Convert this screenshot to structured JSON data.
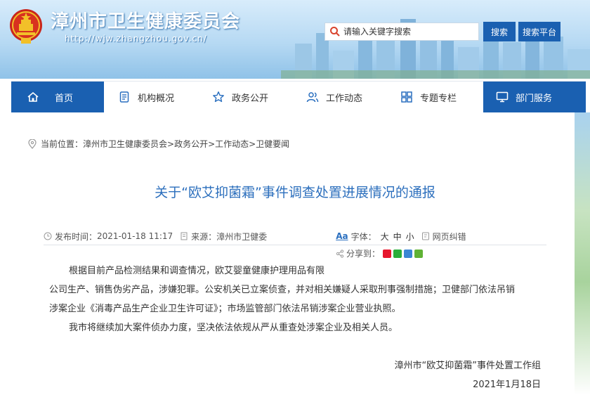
{
  "site": {
    "title": "漳州市卫生健康委员会",
    "url": "http://wjw.zhangzhou.gov.cn/"
  },
  "search": {
    "placeholder": "请输入关键字搜索",
    "search_label": "搜索",
    "platform_label": "搜索平台"
  },
  "nav": {
    "home": "首页",
    "org": "机构概况",
    "gov": "政务公开",
    "work": "工作动态",
    "topic": "专题专栏",
    "service": "部门服务"
  },
  "breadcrumb": {
    "prefix": "当前位置：",
    "path": "漳州市卫生健康委员会>政务公开>工作动态>卫健要闻"
  },
  "article": {
    "title": "关于“欧艾抑菌霜”事件调查处置进展情况的通报",
    "published_label": "发布时间：",
    "published": "2021-01-18 11:17",
    "source_label": "来源：",
    "source": "漳州市卫健委",
    "font_label": "字体：",
    "font_large": "大",
    "font_medium": "中",
    "font_small": "小",
    "error_label": "网页纠错",
    "share_label": "分享到：",
    "paragraphs": [
      "根据目前产品检测结果和调查情况，欧艾婴童健康护理用品有限",
      "公司生产、销售伪劣产品，涉嫌犯罪。公安机关已立案侦查，并对相关嫌疑人采取刑事强制措施；卫健部门依法吊销",
      "涉案企业《消毒产品生产企业卫生许可证》；市场监管部门依法吊销涉案企业营业执照。",
      "我市将继续加大案件侦办力度，坚决依法依规从严从重查处涉案企业及相关人员。"
    ],
    "signature": "漳州市“欧艾抑菌霜”事件处置工作组",
    "date": "2021年1月18日"
  },
  "colors": {
    "primary": "#1a60b1",
    "title_blue": "#2c6fbd"
  }
}
